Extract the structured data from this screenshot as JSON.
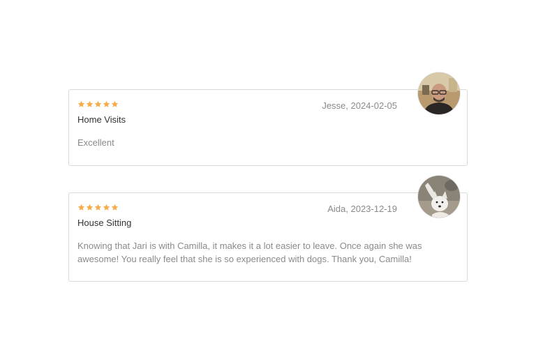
{
  "colors": {
    "star": "#f6ae4d",
    "muted_text": "#8a8a8a",
    "title_text": "#333333",
    "card_border": "#d9d9d9"
  },
  "reviews": [
    {
      "rating": 5,
      "rating_max": 5,
      "author_date": "Jesse, 2024-02-05",
      "service": "Home Visits",
      "comment": "Excellent",
      "avatar_icon": "user-photo-man-glasses"
    },
    {
      "rating": 5,
      "rating_max": 5,
      "author_date": "Aida, 2023-12-19",
      "service": "House Sitting",
      "comment": "Knowing that Jari is with Camilla, it makes it a lot easier to leave. Once again she was awesome! You really feel that she is so experienced with dogs. Thank you, Camilla!",
      "avatar_icon": "user-photo-white-dog"
    }
  ]
}
